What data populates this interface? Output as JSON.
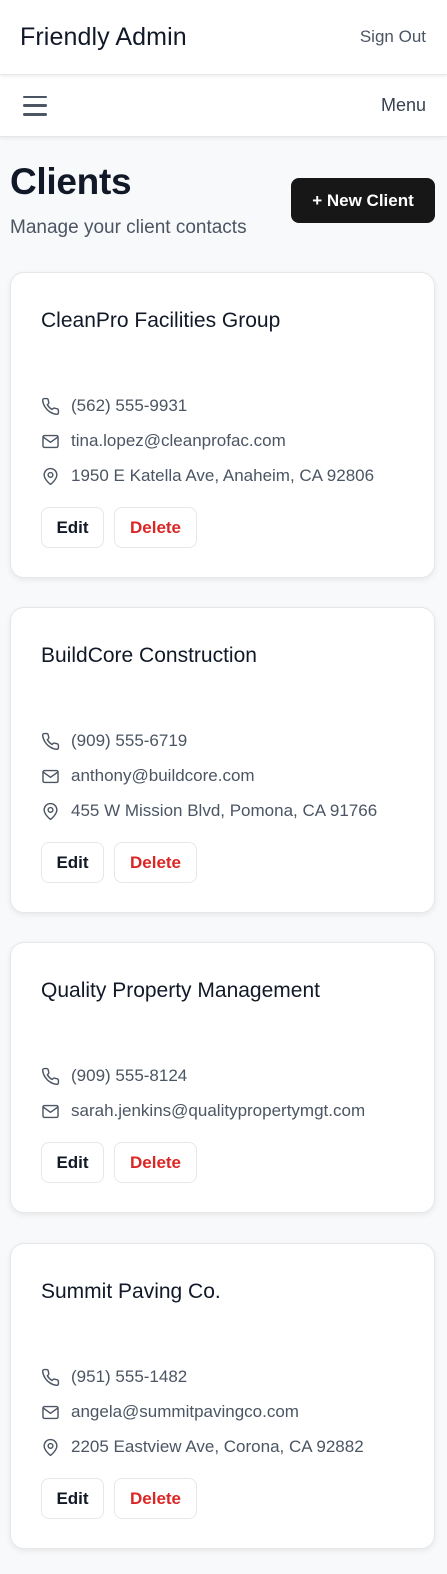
{
  "header": {
    "brand": "Friendly Admin",
    "sign_out": "Sign Out"
  },
  "menubar": {
    "label": "Menu"
  },
  "page": {
    "title": "Clients",
    "subtitle": "Manage your client contacts",
    "new_button": "+ New Client"
  },
  "actions": {
    "edit": "Edit",
    "delete": "Delete"
  },
  "clients": [
    {
      "name": "CleanPro Facilities Group",
      "phone": "(562) 555-9931",
      "email": "tina.lopez@cleanprofac.com",
      "address": "1950 E Katella Ave, Anaheim, CA 92806"
    },
    {
      "name": "BuildCore Construction",
      "phone": "(909) 555-6719",
      "email": "anthony@buildcore.com",
      "address": "455 W Mission Blvd, Pomona, CA 91766"
    },
    {
      "name": "Quality Property Management",
      "phone": "(909) 555-8124",
      "email": "sarah.jenkins@qualitypropertymgt.com"
    },
    {
      "name": "Summit Paving Co.",
      "phone": "(951) 555-1482",
      "email": "angela@summitpavingco.com",
      "address": "2205 Eastview Ave, Corona, CA 92882"
    }
  ],
  "icons": {
    "phone": "phone-icon",
    "email": "mail-icon",
    "address": "map-pin-icon",
    "menu": "hamburger-icon"
  },
  "colors": {
    "primary_button": "#171717",
    "danger_text": "#dc2626",
    "page_bg": "#f8f9fa"
  }
}
